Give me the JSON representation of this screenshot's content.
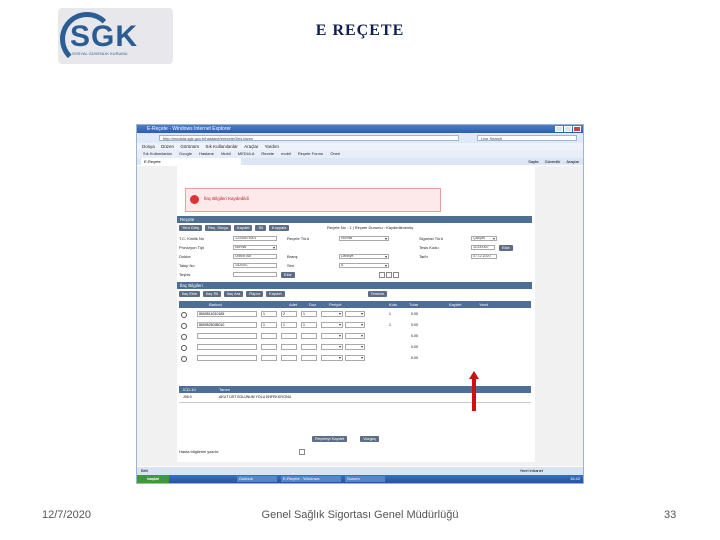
{
  "slide": {
    "title": "E REÇETE",
    "date": "12/7/2020",
    "footer": "Genel Sağlık Sigortası Genel Müdürlüğü",
    "page": "33"
  },
  "logo": {
    "text": "SGK",
    "sub": "SOSYAL GÜVENLİK KURUMU",
    "color": "#2a5d93"
  },
  "browser": {
    "title": "E-Reçete - Windows Internet Explorer",
    "address": "http://medula.sgk.gov.tr/hastane/ereceteGiris.faces",
    "search_placeholder": "Live Search",
    "menu": [
      "Dosya",
      "Düzen",
      "Görünüm",
      "Sık Kullanılanlar",
      "Araçlar",
      "Yardım"
    ],
    "favorites": [
      "Sık Kullanılanlar",
      "Google",
      "Hastane",
      "Mobil",
      "MEDULA",
      "Recete",
      "mobil",
      "Reçete Formu",
      "Öneri"
    ],
    "tab": "E-Reçete",
    "tools": [
      "Sayfa",
      "Güvenlik",
      "Araçlar"
    ],
    "status": "Bitti",
    "zone": "Yerel intranet",
    "taskbar": {
      "start": "başlat",
      "items": [
        "Outlook",
        "E-Reçete - Windows",
        "Sunum"
      ],
      "clock": "16:42"
    }
  },
  "page": {
    "alert": "İlaç Bilgileri Kaydedildi",
    "recete_header": "Reçete",
    "recete_buttons": [
      "Yeni Giriş",
      "Reç. Sorgu",
      "Kaydet",
      "Sil",
      "Kopyala"
    ],
    "recete_info": "Reçete No : 1  |  Reçete Durumu : Kaydedilmemiş",
    "fields": [
      {
        "label": "T.C. Kimlik No",
        "value": "12345678901"
      },
      {
        "label": "Reçete Türü",
        "value": "Normal"
      },
      {
        "label": "Sigortalı Türü",
        "value": "Çalışan"
      },
      {
        "label": "Provizyon Tipi",
        "value": "Normal"
      },
      {
        "label": "Tesis Kodu",
        "value": "11000000"
      },
      {
        "label": "Doktor",
        "value": "Doktor Adı"
      },
      {
        "label": "Branş",
        "value": "Dahiliye"
      },
      {
        "label": "Tarih",
        "value": "07.12.2020"
      },
      {
        "label": "Takip No",
        "value": "1A2B3C"
      },
      {
        "label": "Seri",
        "value": "A"
      }
    ],
    "teshis": {
      "label": "Teşhis",
      "button": "Ekle"
    },
    "ilac_header": "İlaç Bilgileri",
    "ilac_buttons": [
      "İlaç Ekle",
      "İlaç Sil",
      "İlaç Ara",
      "Rapor",
      "Kaydet",
      "Temizle"
    ],
    "ilac_columns": [
      "Barkod",
      "Adet",
      "Doz",
      "Periyot",
      "Kutu",
      "Tutar",
      "Kaydet",
      "Yanıt"
    ],
    "ilac_rows": [
      {
        "barkod": "8699514010185",
        "adet": "1",
        "doz": "2",
        "periyot": "1",
        "kutu": "1",
        "tutar": "0.00"
      },
      {
        "barkod": "8699525095010",
        "adet": "1",
        "doz": "1",
        "periyot": "1",
        "kutu": "1",
        "tutar": "0.00"
      },
      {
        "barkod": "",
        "adet": "",
        "doz": "",
        "periyot": "",
        "kutu": "",
        "tutar": "0.00"
      },
      {
        "barkod": "",
        "adet": "",
        "doz": "",
        "periyot": "",
        "kutu": "",
        "tutar": "0.00"
      },
      {
        "barkod": "",
        "adet": "",
        "doz": "",
        "periyot": "",
        "kutu": "",
        "tutar": "0.00"
      }
    ],
    "diag_columns": [
      "ICD-10",
      "Tanım"
    ],
    "diag_rows": [
      {
        "code": "J06.9",
        "desc": "AKUT ÜST SOLUNUM YOLU ENFEKSİYONU"
      }
    ],
    "bottom_label": "Hasta bilgilerini yazdır:",
    "bottom_buttons": [
      "Reçeteyi Kaydet",
      "Vazgeç"
    ],
    "arrow_color": "#cc1111"
  }
}
